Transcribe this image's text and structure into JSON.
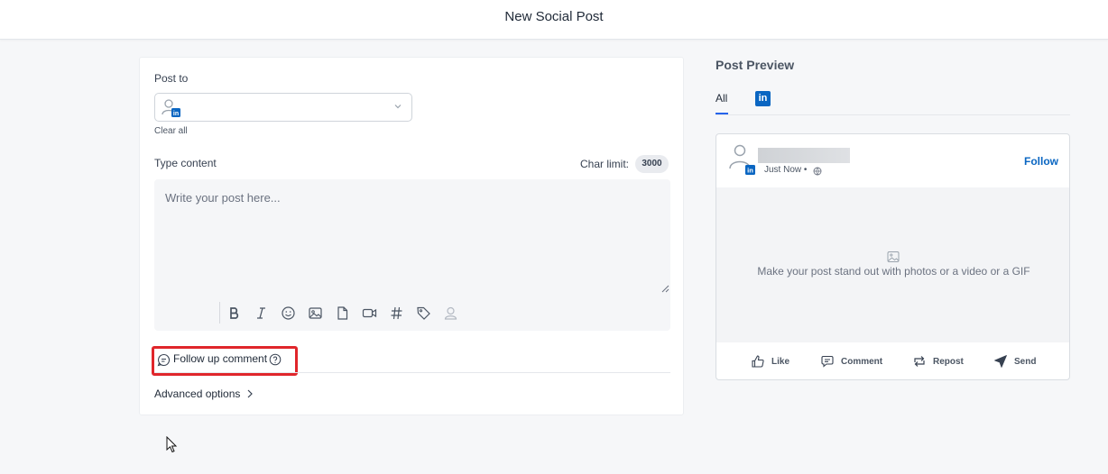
{
  "header": {
    "title": "New Social Post"
  },
  "compose": {
    "post_to_label": "Post to",
    "account_badge": "in",
    "clear_all": "Clear all",
    "type_content_label": "Type content",
    "char_limit_label": "Char limit:",
    "char_limit_value": "3000",
    "editor_placeholder": "Write your post here...",
    "toolbar_icons": [
      "bold-icon",
      "italic-icon",
      "emoji-icon",
      "image-icon",
      "document-icon",
      "video-icon",
      "hashtag-icon",
      "tag-icon",
      "mention-user-icon"
    ],
    "follow_up_label": "Follow up comment",
    "advanced_options": "Advanced options"
  },
  "preview": {
    "title": "Post Preview",
    "tabs": [
      {
        "label": "All"
      },
      {
        "label": "in"
      }
    ],
    "timestamp": "Just Now •",
    "follow": "Follow",
    "media_placeholder": "Make your post stand out with photos or a video or a GIF",
    "actions": [
      {
        "label": "Like"
      },
      {
        "label": "Comment"
      },
      {
        "label": "Repost"
      },
      {
        "label": "Send"
      }
    ]
  },
  "colors": {
    "linkedin_blue": "#0a66c2",
    "accent": "#2563eb",
    "highlight_red": "#e0262b"
  }
}
